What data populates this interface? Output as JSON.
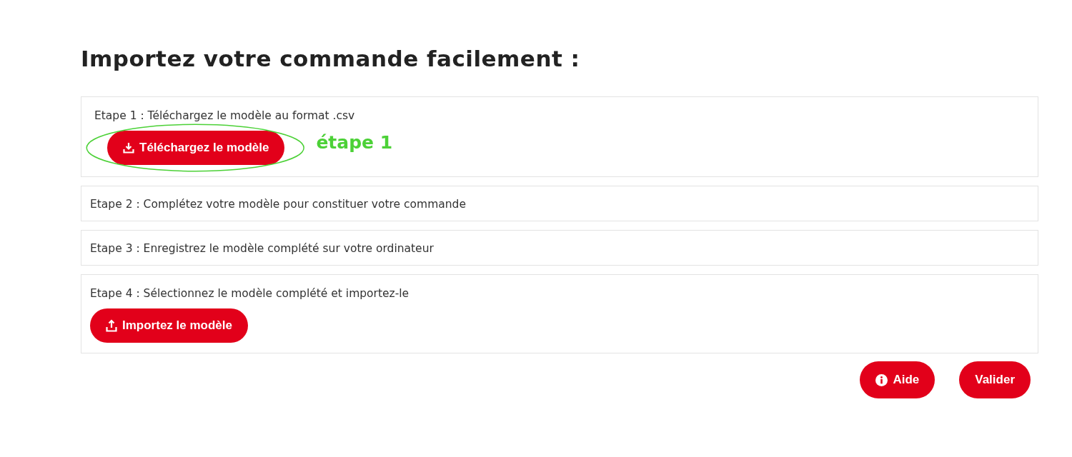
{
  "title": "Importez votre commande facilement :",
  "steps": [
    {
      "text": "Etape 1 : Téléchargez le modèle au format .csv",
      "button": {
        "label": "Téléchargez le modèle",
        "kind": "download"
      },
      "annotation": {
        "text": "étape 1",
        "color": "#4cd137"
      }
    },
    {
      "text": "Etape 2 : Complétez votre modèle pour constituer votre commande"
    },
    {
      "text": "Etape 3 : Enregistrez le modèle complété sur votre ordinateur"
    },
    {
      "text": "Etape 4 : Sélectionnez le modèle complété et importez-le",
      "button": {
        "label": "Importez le modèle",
        "kind": "upload"
      }
    }
  ],
  "footer_buttons": [
    {
      "label": "Aide",
      "kind": "help"
    },
    {
      "label": "Valider",
      "kind": "submit"
    }
  ]
}
